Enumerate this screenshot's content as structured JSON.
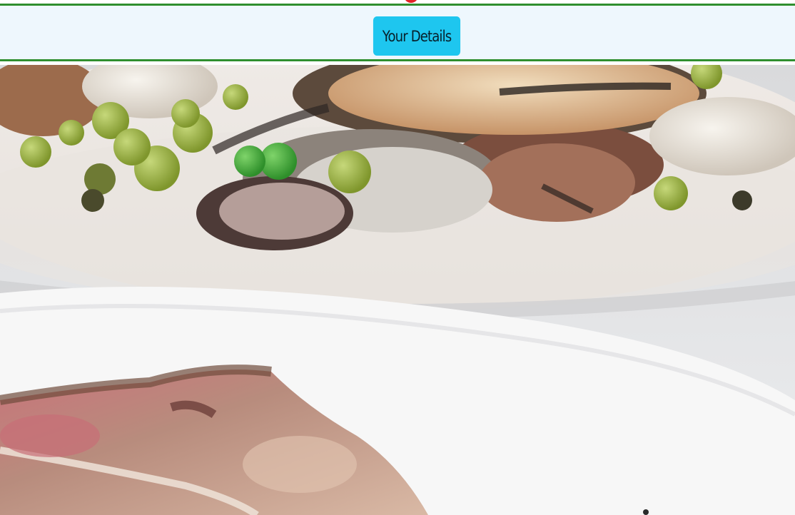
{
  "details_bar": {
    "button_label": "Your Details"
  },
  "photo": {
    "subject": "food-plate-photo"
  },
  "colors": {
    "accent_button": "#1ec6ef",
    "bar_border": "#2f8f2f",
    "bar_background": "#eef7fd",
    "badge": "#e32227"
  }
}
